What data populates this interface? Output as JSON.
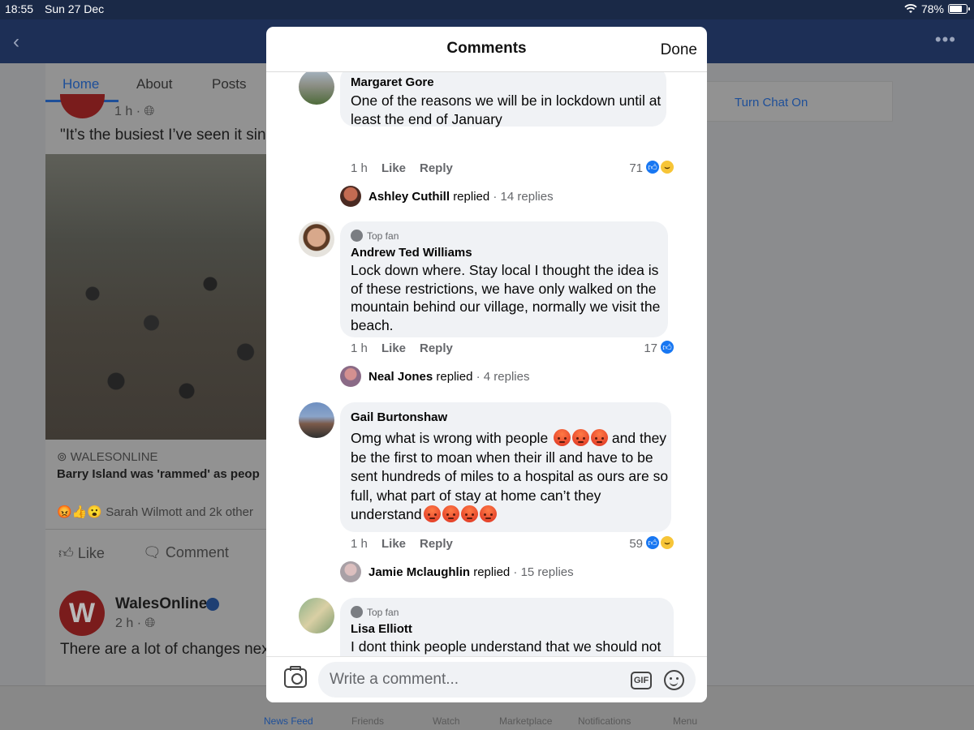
{
  "status_bar": {
    "time": "18:55",
    "date": "Sun 27 Dec",
    "battery": "78%",
    "battery_level": 0.78
  },
  "header": {
    "back_icon": "chevron-left-icon",
    "more_icon": "more-dots-icon"
  },
  "page_tabs": [
    {
      "label": "Home",
      "active": true
    },
    {
      "label": "About",
      "active": false
    },
    {
      "label": "Posts",
      "active": false
    }
  ],
  "chat": {
    "label": "Turn Chat On"
  },
  "post1": {
    "meta": "1 h ·",
    "text": "\"It’s the busiest I’ve seen it sin",
    "source": "WALESONLINE",
    "headline": "Barry Island was 'rammed' as peop",
    "reactions_summary": "Sarah Wilmott and 2k other",
    "like_label": "Like",
    "comment_label": "Comment"
  },
  "post2": {
    "page_name": "WalesOnline",
    "logo_letter": "W",
    "meta": "2 h ·",
    "text": "There are a lot of changes nex"
  },
  "bottom_nav": [
    {
      "label": "News Feed",
      "active": true
    },
    {
      "label": "Friends",
      "active": false
    },
    {
      "label": "Watch",
      "active": false
    },
    {
      "label": "Marketplace",
      "active": false
    },
    {
      "label": "Notifications",
      "active": false
    },
    {
      "label": "Menu",
      "active": false
    }
  ],
  "modal": {
    "title": "Comments",
    "done_label": "Done",
    "comments": [
      {
        "author": "Margaret Gore",
        "text": "One of the reasons we will be in lockdown until at least the end of January",
        "time": "1 h",
        "like_label": "Like",
        "reply_label": "Reply",
        "reaction_count": "71",
        "reaction_icons": [
          "like",
          "haha"
        ],
        "reply_preview": {
          "name": "Ashley Cuthill",
          "verb": "replied",
          "count": "· 14 replies"
        }
      },
      {
        "badge": "Top fan",
        "author": "Andrew Ted Williams",
        "text": "Lock down where. Stay local I thought the idea is of these restrictions, we have only walked on the mountain behind our village, normally we visit the beach.",
        "time": "1 h",
        "like_label": "Like",
        "reply_label": "Reply",
        "reaction_count": "17",
        "reaction_icons": [
          "like"
        ],
        "reply_preview": {
          "name": "Neal Jones",
          "verb": "replied",
          "count": "· 4 replies"
        }
      },
      {
        "author": "Gail Burtonshaw",
        "text_part1": "Omg what is wrong with people",
        "text_part2": " and they be the first to moan when their ill and have to be sent hundreds of miles to a hospital as ours are so full, what part of stay at home can’t they understand",
        "emoji": "angry-face",
        "time": "1 h",
        "like_label": "Like",
        "reply_label": "Reply",
        "reaction_count": "59",
        "reaction_icons": [
          "like",
          "haha"
        ],
        "reply_preview": {
          "name": "Jamie Mclaughlin",
          "verb": "replied",
          "count": "· 15 replies"
        }
      },
      {
        "badge": "Top fan",
        "author": "Lisa Elliott",
        "text": "I dont think people understand that we should not be going out. Not sure how they can get the"
      }
    ],
    "composer": {
      "placeholder": "Write a comment...",
      "gif_label": "GIF"
    }
  },
  "colors": {
    "header_bg": "#1d2f56",
    "accent": "#1877f2",
    "bubble": "#f0f2f5",
    "link": "#1e4f99"
  }
}
